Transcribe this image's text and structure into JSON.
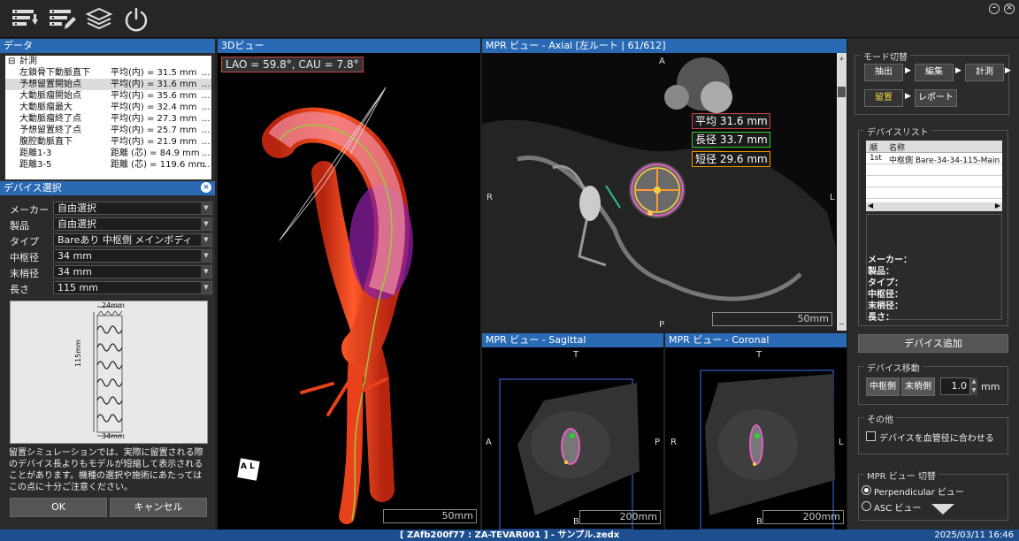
{
  "toolbar": {
    "icons": [
      "list-down-icon",
      "list-edit-icon",
      "layers-icon",
      "power-icon"
    ]
  },
  "data_panel": {
    "title": "データ",
    "tree_label": "計測",
    "rows": [
      {
        "name": "左鎖骨下動脈直下",
        "value": "平均(内) = 31.5 mm"
      },
      {
        "name": "予想留置開始点",
        "value": "平均(内) = 31.6 mm"
      },
      {
        "name": "大動脈瘤開始点",
        "value": "平均(内) = 35.6 mm"
      },
      {
        "name": "大動脈瘤最大",
        "value": "平均(内) = 32.4 mm"
      },
      {
        "name": "大動脈瘤終了点",
        "value": "平均(内) = 27.3 mm"
      },
      {
        "name": "予想留置終了点",
        "value": "平均(内) = 25.7 mm"
      },
      {
        "name": "腹腔動脈直下",
        "value": "平均(内) = 21.9 mm"
      },
      {
        "name": "距離1-3",
        "value": "距離 (芯) = 84.9 mm"
      },
      {
        "name": "距離3-5",
        "value": "距離 (芯) = 119.6 mm"
      }
    ],
    "ellipsis": "..."
  },
  "device_select": {
    "title": "デバイス選択",
    "fields": [
      {
        "label": "メーカー",
        "value": "自由選択"
      },
      {
        "label": "製品",
        "value": "自由選択"
      },
      {
        "label": "タイプ",
        "value": "Bareあり 中枢側 メインボディ"
      },
      {
        "label": "中枢径",
        "value": "34 mm"
      },
      {
        "label": "末梢径",
        "value": "34 mm"
      },
      {
        "label": "長さ",
        "value": "115 mm"
      }
    ],
    "dim_top": "24mm",
    "dim_side": "115mm",
    "dim_bottom": "34mm",
    "note": "留置シミュレーションでは、実際に留置される際のデバイス長よりもモデルが短縮して表示されることがあります。機種の選択や施術にあたってはこの点に十分ご注意ください。",
    "ok": "OK",
    "cancel": "キャンセル"
  },
  "view3d": {
    "title": "3Dビュー",
    "angle": "LAO = 59.8°, CAU = 7.8°",
    "scale": "50mm",
    "badge": "A L"
  },
  "axial": {
    "title": "MPR ビュー - Axial [左ルート | 61/612]",
    "avg": "平均 31.6 mm",
    "long": "長径 33.7 mm",
    "short": "短径 29.6 mm",
    "scale": "50mm",
    "A": "A",
    "P": "P",
    "R": "R",
    "L": "L"
  },
  "sagittal": {
    "title": "MPR ビュー - Sagittal",
    "scale": "200mm",
    "T": "T",
    "B": "B",
    "A": "A",
    "P": "P"
  },
  "coronal": {
    "title": "MPR ビュー - Coronal",
    "scale": "200mm",
    "T": "T",
    "B": "B",
    "R": "R",
    "L": "L"
  },
  "right": {
    "mode_title": "モード切替",
    "modes": [
      {
        "label": "抽出"
      },
      {
        "label": "編集"
      },
      {
        "label": "計測"
      },
      {
        "label": "留置"
      },
      {
        "label": "レポート"
      }
    ],
    "device_list_title": "デバイスリスト",
    "col_order": "順",
    "col_name": "名称",
    "device_row": {
      "order": "1st",
      "name": "中枢側 Bare-34-34-115-Main"
    },
    "info": [
      "メーカー：",
      "製品：",
      "タイプ：",
      "中枢径：",
      "末梢径：",
      "長さ："
    ],
    "add_device": "デバイス追加",
    "move_title": "デバイス移動",
    "move_central": "中枢側",
    "move_distal": "末梢側",
    "move_value": "1.0",
    "move_unit": "mm",
    "other_title": "その他",
    "fit_check": "デバイスを血管径に合わせる",
    "mpr_title": "MPR ビュー 切替",
    "perp": "Perpendicular ビュー",
    "asc": "ASC ビュー"
  },
  "status": {
    "file": "[ ZAfb200f77 : ZA-TEVAR001 ] - サンプル.zedx",
    "datetime": "2025/03/11 16:46"
  }
}
